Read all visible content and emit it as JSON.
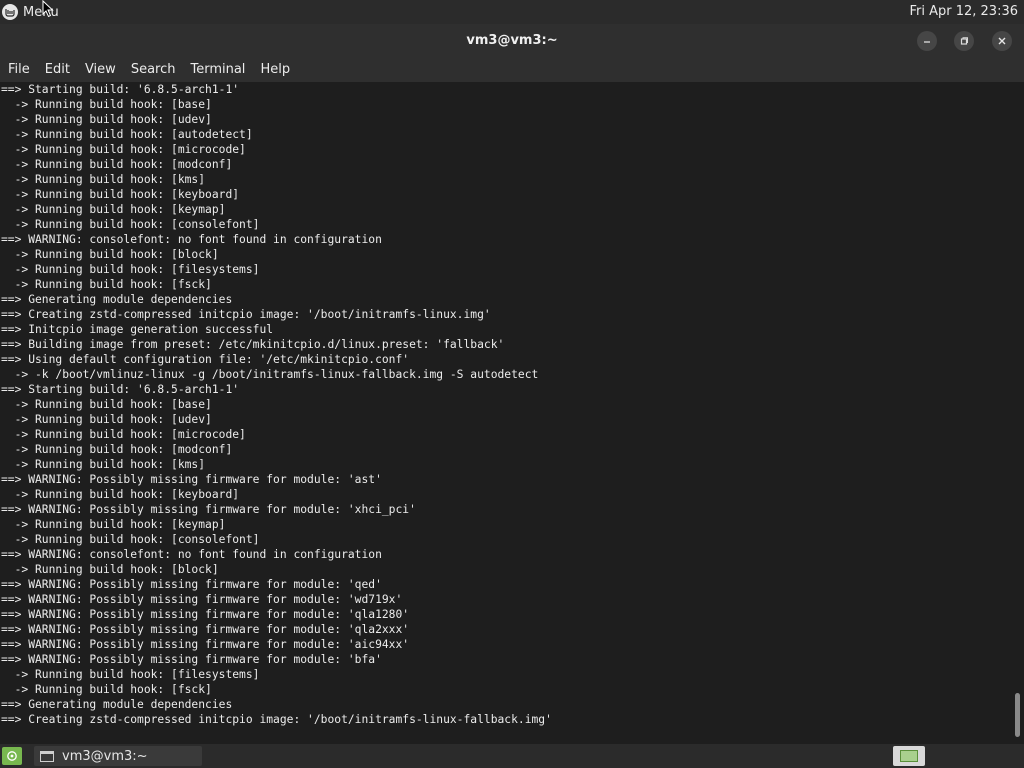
{
  "top_panel": {
    "menu_label": "Menu",
    "clock": "Fri Apr 12, 23:36"
  },
  "window": {
    "title": "vm3@vm3:~"
  },
  "menubar": {
    "items": [
      "File",
      "Edit",
      "View",
      "Search",
      "Terminal",
      "Help"
    ]
  },
  "terminal": {
    "lines": [
      "==> Starting build: '6.8.5-arch1-1'",
      "  -> Running build hook: [base]",
      "  -> Running build hook: [udev]",
      "  -> Running build hook: [autodetect]",
      "  -> Running build hook: [microcode]",
      "  -> Running build hook: [modconf]",
      "  -> Running build hook: [kms]",
      "  -> Running build hook: [keyboard]",
      "  -> Running build hook: [keymap]",
      "  -> Running build hook: [consolefont]",
      "==> WARNING: consolefont: no font found in configuration",
      "  -> Running build hook: [block]",
      "  -> Running build hook: [filesystems]",
      "  -> Running build hook: [fsck]",
      "==> Generating module dependencies",
      "==> Creating zstd-compressed initcpio image: '/boot/initramfs-linux.img'",
      "==> Initcpio image generation successful",
      "==> Building image from preset: /etc/mkinitcpio.d/linux.preset: 'fallback'",
      "==> Using default configuration file: '/etc/mkinitcpio.conf'",
      "  -> -k /boot/vmlinuz-linux -g /boot/initramfs-linux-fallback.img -S autodetect",
      "==> Starting build: '6.8.5-arch1-1'",
      "  -> Running build hook: [base]",
      "  -> Running build hook: [udev]",
      "  -> Running build hook: [microcode]",
      "  -> Running build hook: [modconf]",
      "  -> Running build hook: [kms]",
      "==> WARNING: Possibly missing firmware for module: 'ast'",
      "  -> Running build hook: [keyboard]",
      "==> WARNING: Possibly missing firmware for module: 'xhci_pci'",
      "  -> Running build hook: [keymap]",
      "  -> Running build hook: [consolefont]",
      "==> WARNING: consolefont: no font found in configuration",
      "  -> Running build hook: [block]",
      "==> WARNING: Possibly missing firmware for module: 'qed'",
      "==> WARNING: Possibly missing firmware for module: 'wd719x'",
      "==> WARNING: Possibly missing firmware for module: 'qla1280'",
      "==> WARNING: Possibly missing firmware for module: 'qla2xxx'",
      "==> WARNING: Possibly missing firmware for module: 'aic94xx'",
      "==> WARNING: Possibly missing firmware for module: 'bfa'",
      "  -> Running build hook: [filesystems]",
      "  -> Running build hook: [fsck]",
      "==> Generating module dependencies",
      "==> Creating zstd-compressed initcpio image: '/boot/initramfs-linux-fallback.img'"
    ]
  },
  "taskbar": {
    "window_label": "vm3@vm3:~"
  },
  "icons": {
    "menu": "mint-logo-icon",
    "minimize": "minimize-icon",
    "maximize": "restore-icon",
    "close": "close-icon",
    "terminal_task": "terminal-window-icon",
    "workspace": "workspace-switcher-icon"
  },
  "colors": {
    "terminal_bg": "#1e1e1e",
    "terminal_fg": "#ececec",
    "panel_bg": "#2b2b2b",
    "accent_green": "#78b84f"
  }
}
